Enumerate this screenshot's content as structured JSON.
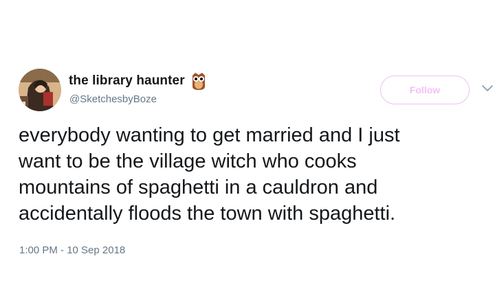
{
  "user": {
    "display_name": "the library haunter",
    "handle": "@SketchesbyBoze",
    "badge_icon": "owl-emoji-icon",
    "avatar_icon": "profile-avatar"
  },
  "actions": {
    "follow_label": "Follow",
    "more_icon": "chevron-down-icon"
  },
  "tweet": {
    "lines": [
      "everybody wanting to get married and I just",
      "want to be the village witch who cooks",
      "mountains of spaghetti in a cauldron and",
      "accidentally floods the town with spaghetti."
    ],
    "timestamp": "1:00 PM - 10 Sep 2018"
  },
  "colors": {
    "text": "#14171a",
    "secondary": "#657786",
    "follow_accent": "#f3c0f7"
  }
}
